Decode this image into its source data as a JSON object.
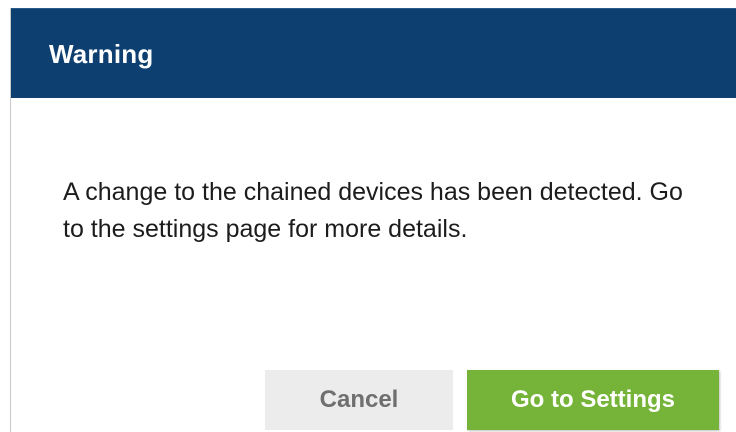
{
  "dialog": {
    "title": "Warning",
    "message": "A change to the chained devices has been detected. Go to the settings page for more details.",
    "buttons": {
      "cancel_label": "Cancel",
      "primary_label": "Go to Settings"
    }
  },
  "colors": {
    "header_background": "#0d3f70",
    "primary_button": "#75b438",
    "cancel_button": "#ececec"
  }
}
